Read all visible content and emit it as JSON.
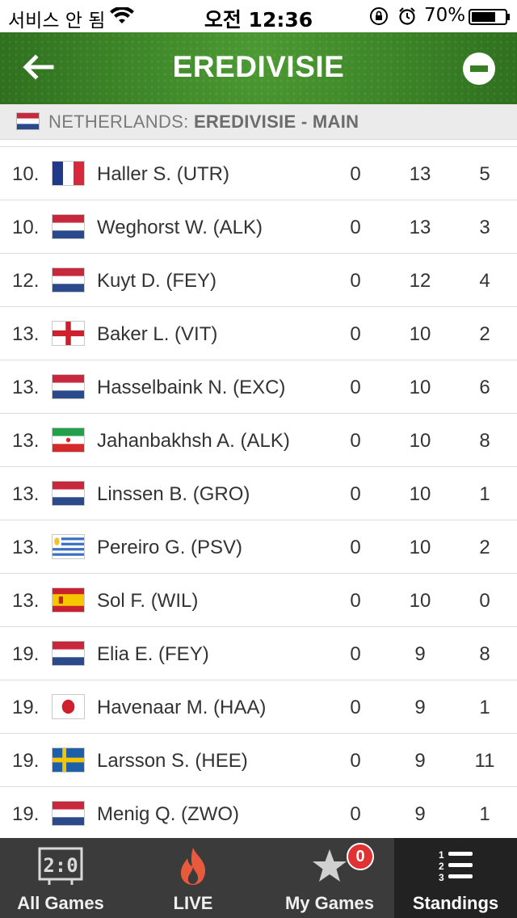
{
  "status_bar": {
    "carrier": "서비스 안 됨",
    "time": "오전 12:36",
    "battery_percent": "70%"
  },
  "header": {
    "title": "EREDIVISIE"
  },
  "league_bar": {
    "country": "NETHERLANDS:",
    "league": "EREDIVISIE - MAIN"
  },
  "rows": [
    {
      "rank": "10.",
      "flag": "france",
      "player": "Haller S. (UTR)",
      "c1": "0",
      "c2": "13",
      "c3": "5"
    },
    {
      "rank": "10.",
      "flag": "netherlands",
      "player": "Weghorst W. (ALK)",
      "c1": "0",
      "c2": "13",
      "c3": "3"
    },
    {
      "rank": "12.",
      "flag": "netherlands",
      "player": "Kuyt D. (FEY)",
      "c1": "0",
      "c2": "12",
      "c3": "4"
    },
    {
      "rank": "13.",
      "flag": "england",
      "player": "Baker L. (VIT)",
      "c1": "0",
      "c2": "10",
      "c3": "2"
    },
    {
      "rank": "13.",
      "flag": "netherlands",
      "player": "Hasselbaink N. (EXC)",
      "c1": "0",
      "c2": "10",
      "c3": "6"
    },
    {
      "rank": "13.",
      "flag": "iran",
      "player": "Jahanbakhsh A. (ALK)",
      "c1": "0",
      "c2": "10",
      "c3": "8"
    },
    {
      "rank": "13.",
      "flag": "netherlands",
      "player": "Linssen B. (GRO)",
      "c1": "0",
      "c2": "10",
      "c3": "1"
    },
    {
      "rank": "13.",
      "flag": "uruguay",
      "player": "Pereiro G. (PSV)",
      "c1": "0",
      "c2": "10",
      "c3": "2"
    },
    {
      "rank": "13.",
      "flag": "spain",
      "player": "Sol F. (WIL)",
      "c1": "0",
      "c2": "10",
      "c3": "0"
    },
    {
      "rank": "19.",
      "flag": "netherlands",
      "player": "Elia E. (FEY)",
      "c1": "0",
      "c2": "9",
      "c3": "8"
    },
    {
      "rank": "19.",
      "flag": "japan",
      "player": "Havenaar M. (HAA)",
      "c1": "0",
      "c2": "9",
      "c3": "1"
    },
    {
      "rank": "19.",
      "flag": "sweden",
      "player": "Larsson S. (HEE)",
      "c1": "0",
      "c2": "9",
      "c3": "11"
    },
    {
      "rank": "19.",
      "flag": "netherlands",
      "player": "Menig Q. (ZWO)",
      "c1": "0",
      "c2": "9",
      "c3": "1"
    }
  ],
  "tabs": {
    "all_games": {
      "label": "All Games",
      "icon": "scoreboard-icon",
      "score_text": "2:0"
    },
    "live": {
      "label": "LIVE",
      "icon": "flame-icon"
    },
    "my_games": {
      "label": "My Games",
      "icon": "star-icon",
      "badge": "0"
    },
    "standings": {
      "label": "Standings",
      "icon": "numbered-list-icon",
      "numbers": [
        "1",
        "2",
        "3"
      ]
    }
  },
  "colors": {
    "header_green": "#377d24",
    "tab_bar": "#3b3b3b",
    "tab_active": "#222222",
    "badge_red": "#e03232",
    "live_icon": "#e85a3c"
  }
}
